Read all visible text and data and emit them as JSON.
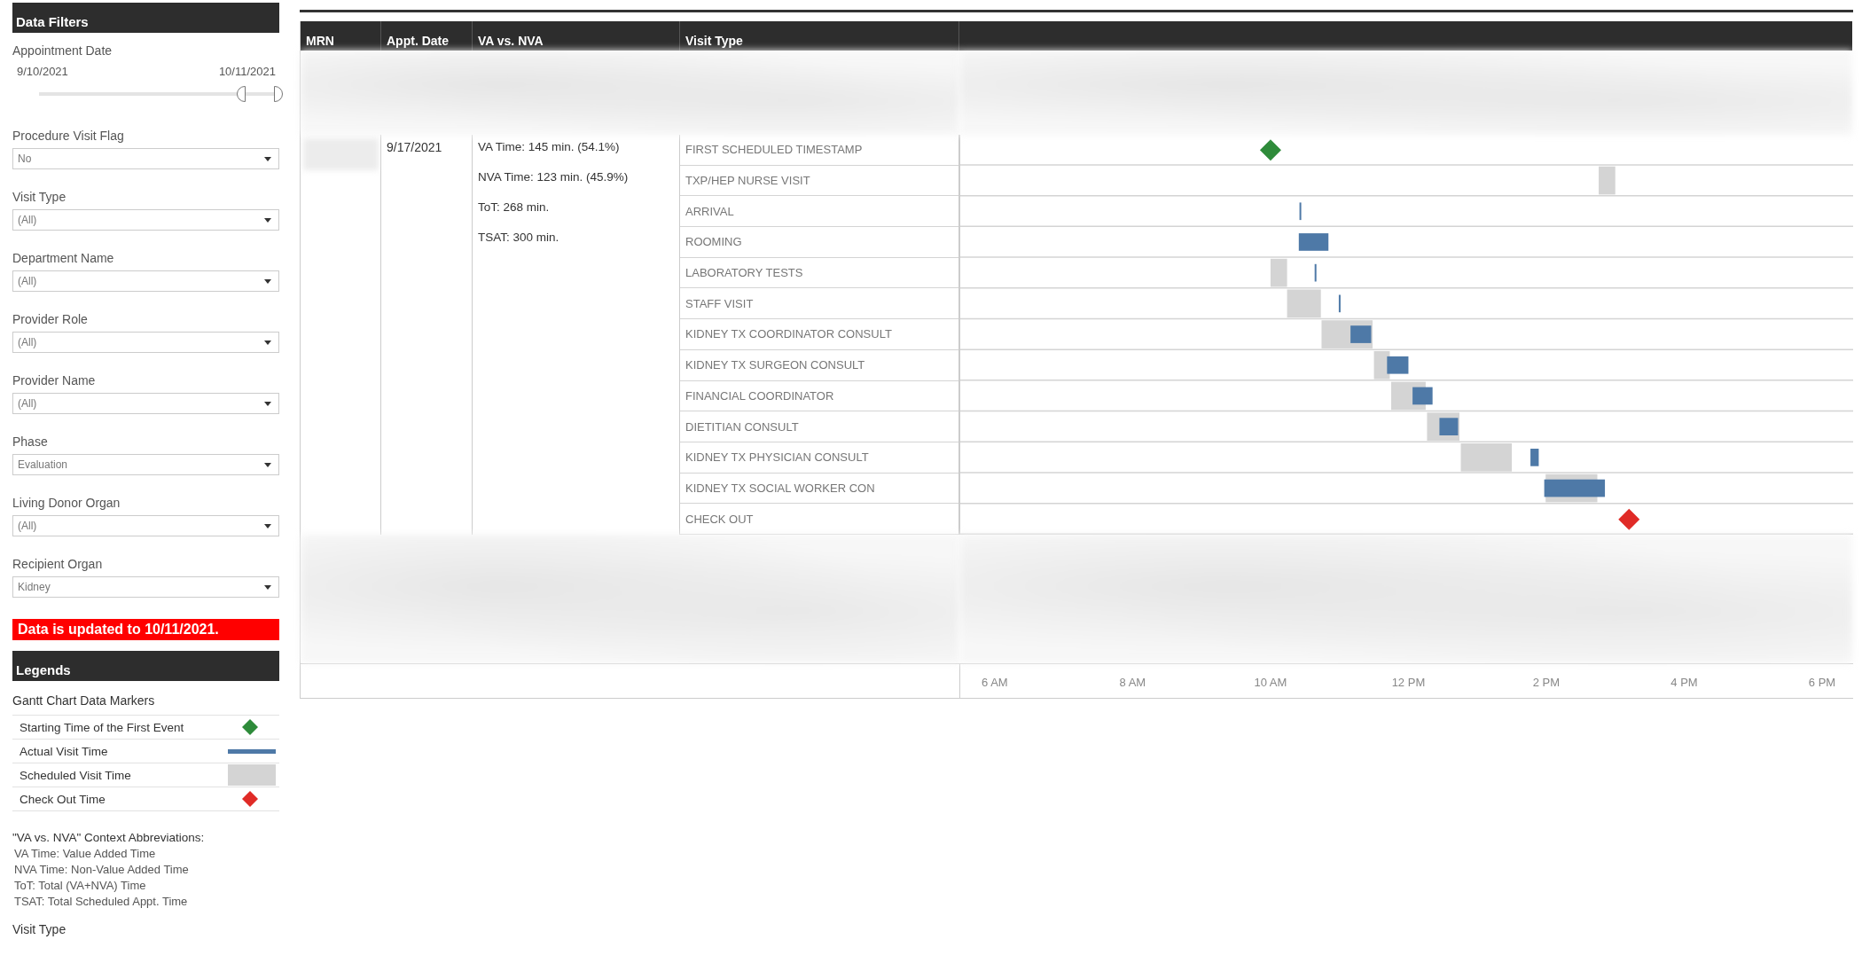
{
  "filters": {
    "title": "Data Filters",
    "date_range": {
      "label": "Appointment Date",
      "start": "9/10/2021",
      "end": "10/11/2021",
      "thumbs": [
        {
          "level": 0.88
        },
        {
          "level": 1
        }
      ]
    },
    "dropdowns": [
      {
        "label": "Procedure Visit Flag",
        "value": "No"
      },
      {
        "label": "Visit Type",
        "value": "(All)"
      },
      {
        "label": "Department Name",
        "value": "(All)"
      },
      {
        "label": "Provider Role",
        "value": "(All)"
      },
      {
        "label": "Provider Name",
        "value": "(All)"
      },
      {
        "label": "Phase",
        "value": "Evaluation"
      },
      {
        "label": "Living Donor Organ",
        "value": "(All)"
      },
      {
        "label": "Recipient Organ",
        "value": "Kidney"
      }
    ],
    "notice": "Data is updated to 10/11/2021."
  },
  "legends": {
    "title": "Legends",
    "subtitle": "Gantt Chart Data Markers",
    "items": [
      {
        "label": "Starting Time of the First Event",
        "kind": "diamond",
        "color": "#2e8b3a"
      },
      {
        "label": "Actual Visit Time",
        "kind": "line",
        "color": "#4e79a7"
      },
      {
        "label": "Scheduled Visit Time",
        "kind": "block",
        "color": "#d4d4d4"
      },
      {
        "label": "Check Out Time",
        "kind": "diamond",
        "color": "#e02b27"
      }
    ],
    "abbreviations_title": "\"VA vs. NVA\" Context Abbreviations:",
    "abbreviations": [
      "VA Time: Value Added Time",
      "NVA Time: Non-Value Added Time",
      "ToT: Total (VA+NVA) Time",
      "TSAT: Total Scheduled Appt. Time"
    ],
    "footer_heading": "Visit Type"
  },
  "table": {
    "columns": [
      "MRN",
      "Appt. Date",
      "VA vs. NVA",
      "Visit Type"
    ],
    "row": {
      "appt_date": "9/17/2021",
      "va_lines": [
        "VA Time: 145 min. (54.1%)",
        "NVA Time: 123 min. (45.9%)",
        "ToT: 268 min.",
        "TSAT: 300 min."
      ]
    },
    "visit_types": [
      "FIRST SCHEDULED TIMESTAMP",
      "TXP/HEP NURSE VISIT",
      "ARRIVAL",
      "ROOMING",
      "LABORATORY TESTS",
      "STAFF VISIT",
      "KIDNEY TX COORDINATOR CONSULT",
      "KIDNEY TX SURGEON CONSULT",
      "FINANCIAL COORDINATOR",
      "DIETITIAN CONSULT",
      "KIDNEY TX PHYSICIAN CONSULT",
      "KIDNEY TX SOCIAL WORKER CON",
      "CHECK OUT"
    ],
    "time_axis": [
      "6 AM",
      "8 AM",
      "10 AM",
      "12 PM",
      "2 PM",
      "4 PM",
      "6 PM"
    ]
  }
}
